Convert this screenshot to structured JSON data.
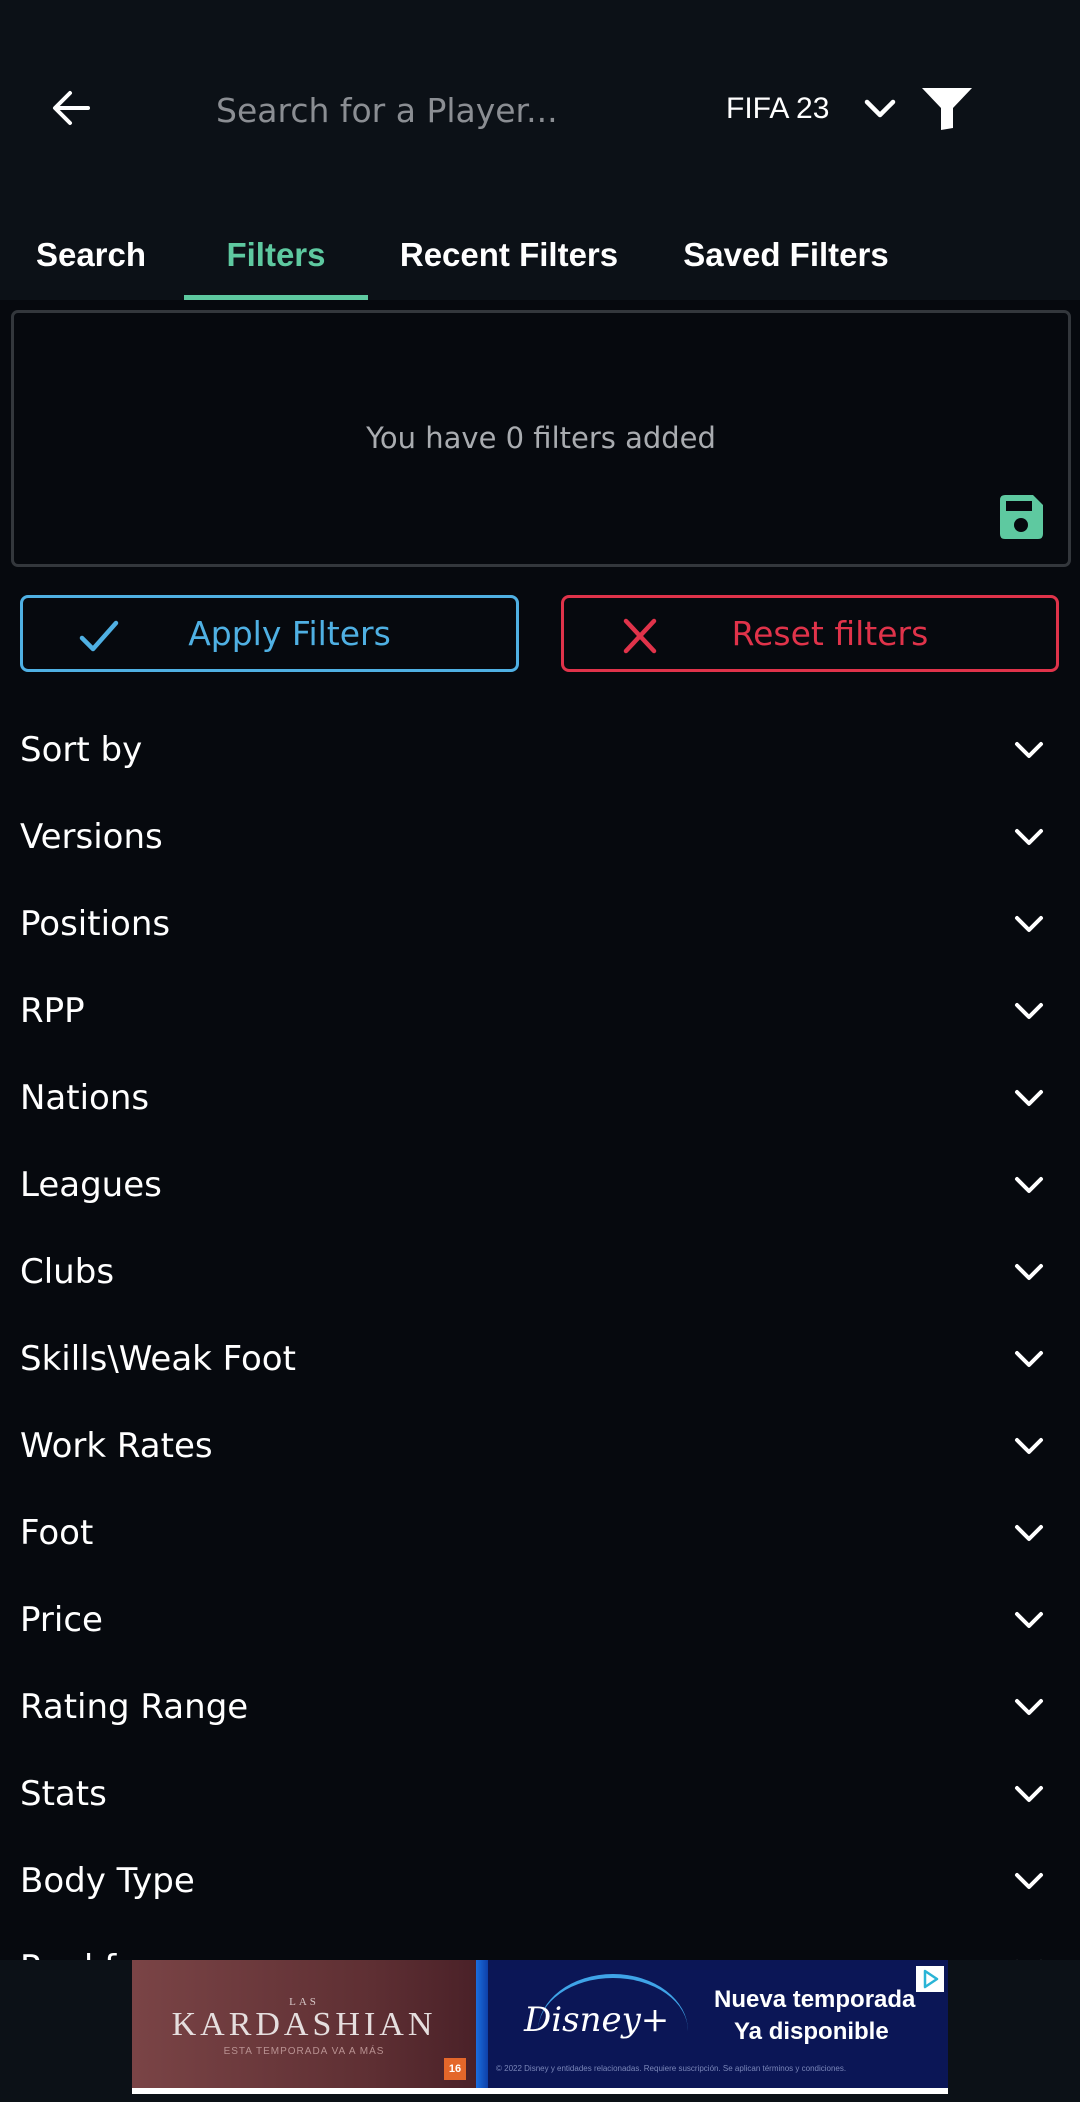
{
  "header": {
    "search_placeholder": "Search for a Player...",
    "game_version": "FIFA 23",
    "icons": {
      "back": "arrow-left-icon",
      "game_dropdown": "chevron-down-icon",
      "filter": "funnel-icon"
    }
  },
  "tabs": [
    {
      "label": "Search",
      "active": false
    },
    {
      "label": "Filters",
      "active": true
    },
    {
      "label": "Recent Filters",
      "active": false
    },
    {
      "label": "Saved Filters",
      "active": false
    }
  ],
  "filters_summary": {
    "message": "You have 0 filters added",
    "filter_count": 0,
    "save_icon": "floppy-disk-icon"
  },
  "actions": {
    "apply_label": "Apply Filters",
    "apply_icon": "check-icon",
    "reset_label": "Reset filters",
    "reset_icon": "close-icon"
  },
  "filter_sections": [
    {
      "label": "Sort by"
    },
    {
      "label": "Versions"
    },
    {
      "label": "Positions"
    },
    {
      "label": "RPP"
    },
    {
      "label": "Nations"
    },
    {
      "label": "Leagues"
    },
    {
      "label": "Clubs"
    },
    {
      "label": "Skills\\Weak Foot"
    },
    {
      "label": "Work Rates"
    },
    {
      "label": "Foot"
    },
    {
      "label": "Price"
    },
    {
      "label": "Rating Range"
    },
    {
      "label": "Stats"
    },
    {
      "label": "Body Type"
    },
    {
      "label": "Real face"
    }
  ],
  "ad": {
    "left_small": "LAS",
    "left_title": "KARDASHIAN",
    "left_subtitle": "ESTA TEMPORADA VA A MÁS",
    "age_rating": "16",
    "brand": "Disney+",
    "line1": "Nueva temporada",
    "line2": "Ya disponible",
    "legal": "© 2022 Disney y entidades relacionadas. Requiere suscripción. Se aplican términos y condiciones."
  },
  "colors": {
    "accent_green": "#5ec9a0",
    "apply_blue": "#4fb0e3",
    "reset_red": "#e0334a",
    "background": "#06090e",
    "header_bg": "#0c1117"
  }
}
